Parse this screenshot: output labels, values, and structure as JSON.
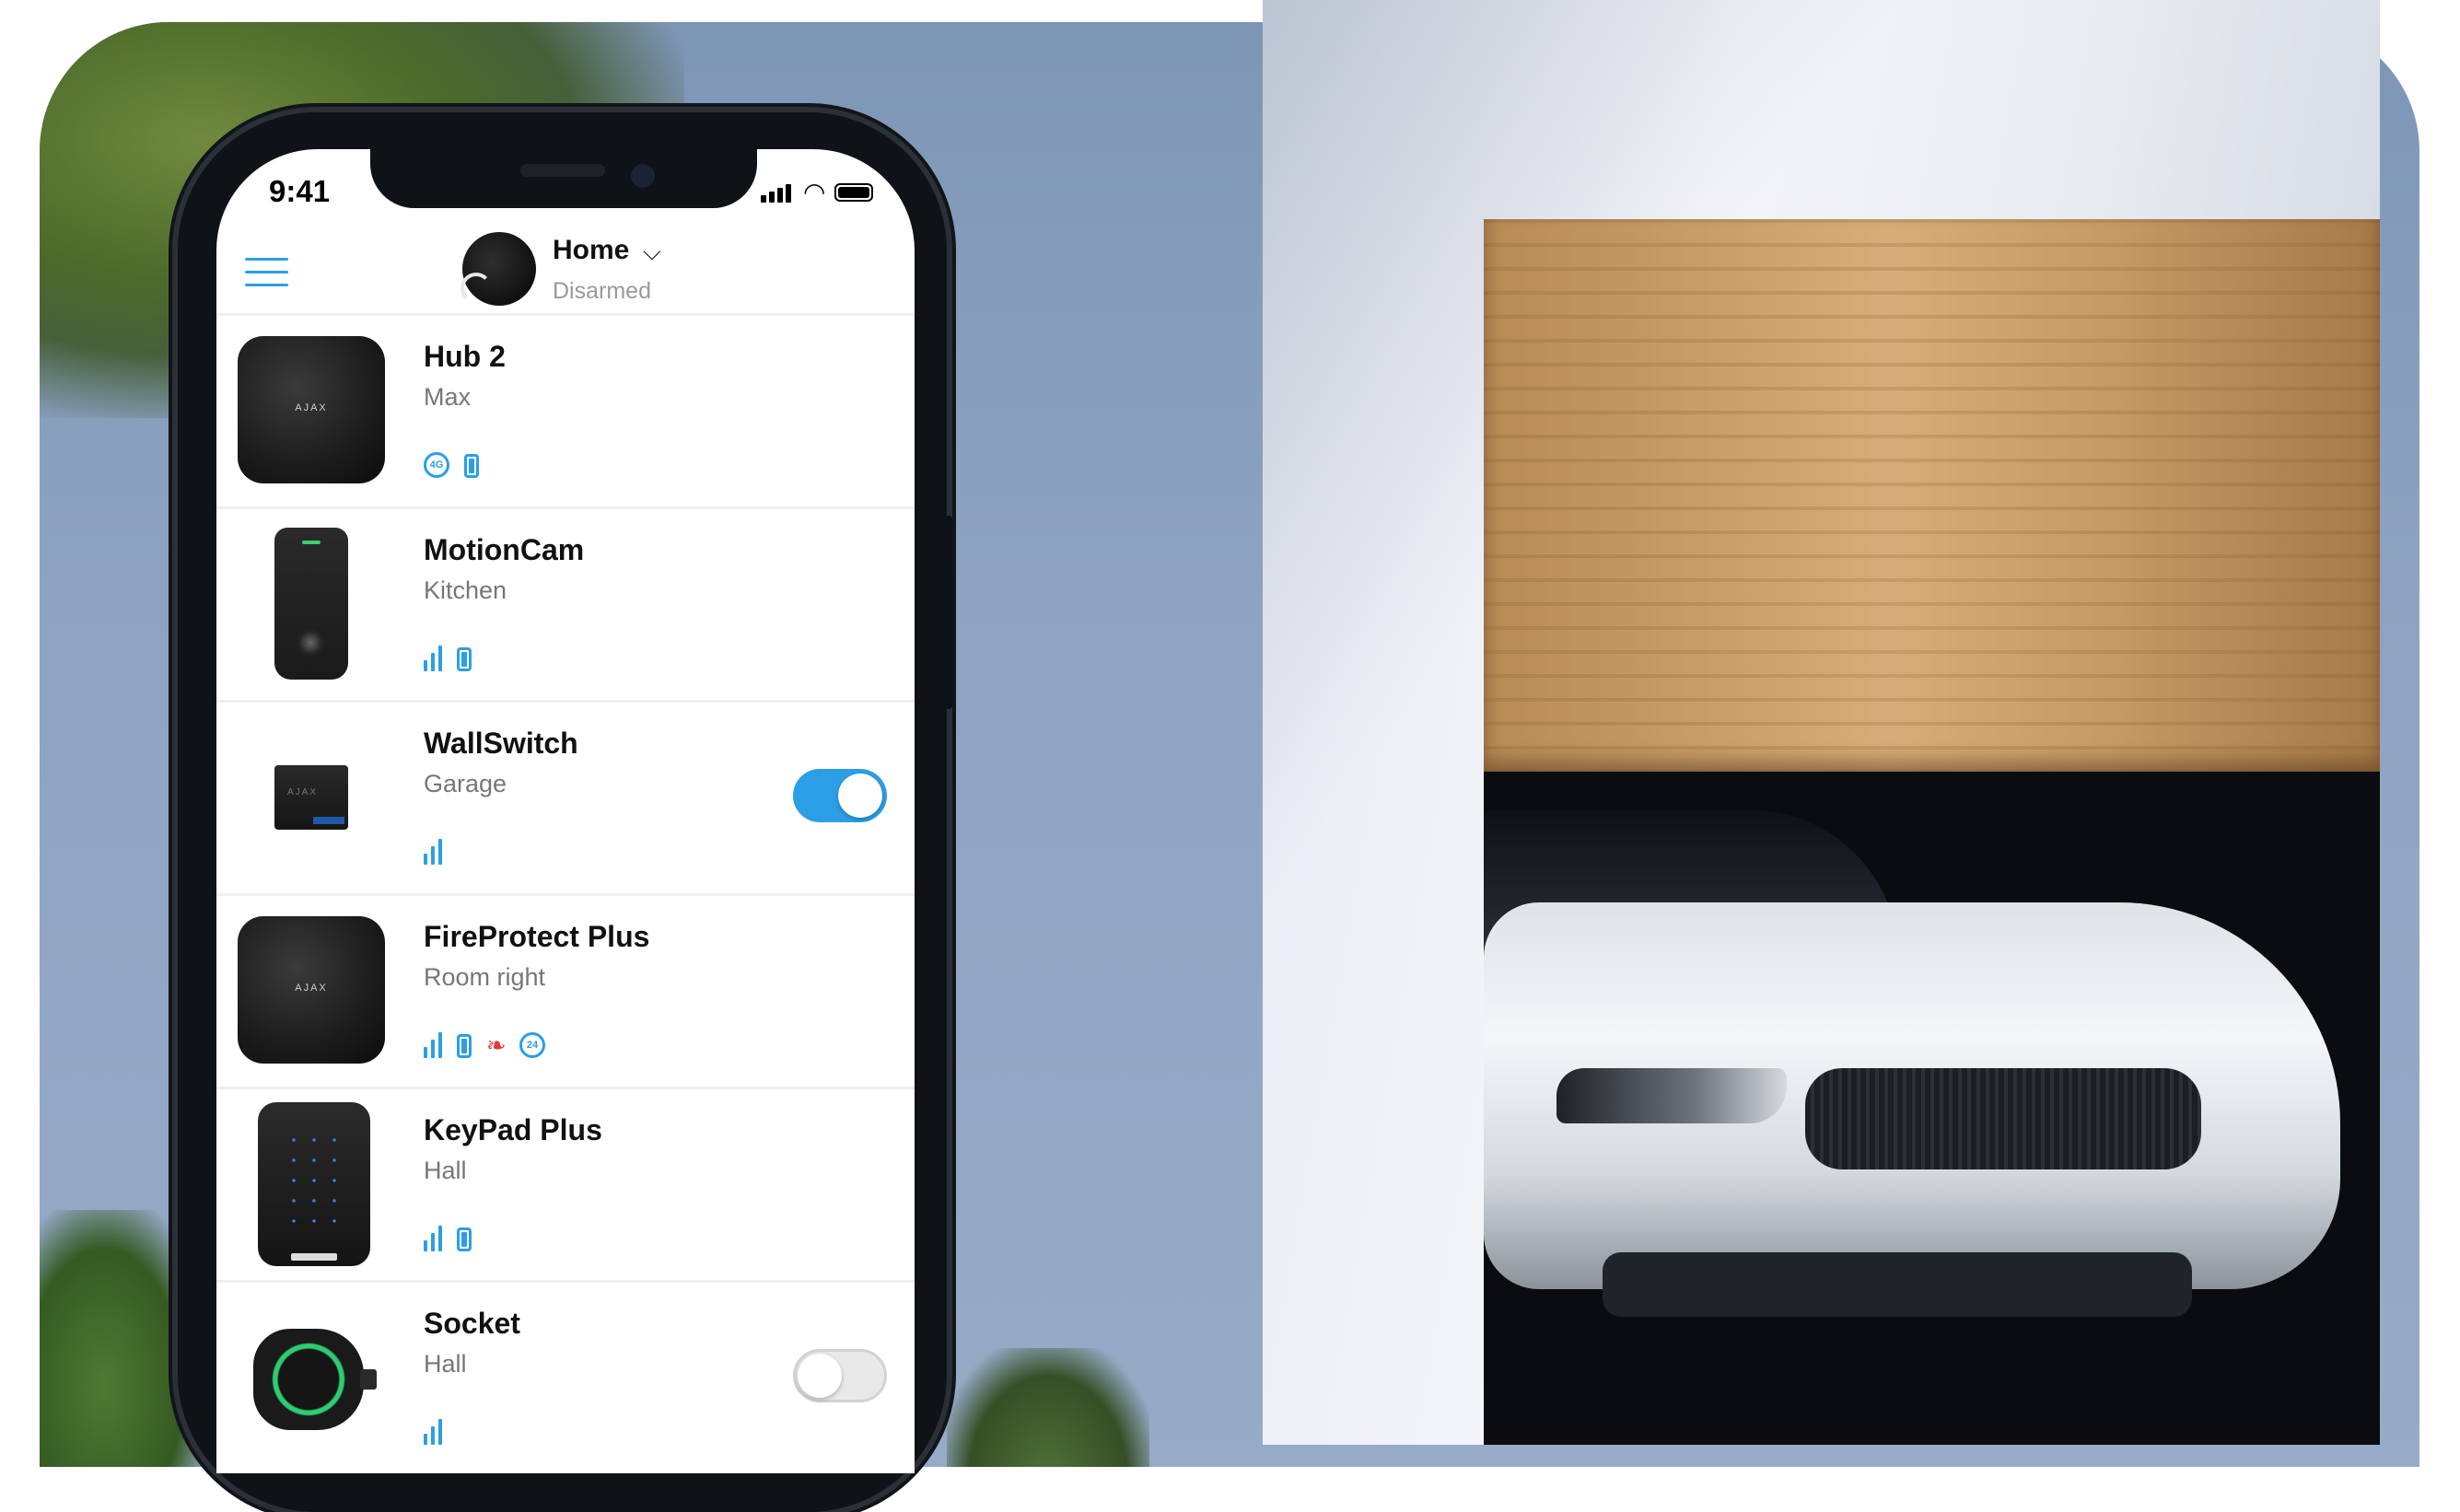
{
  "status_bar": {
    "time": "9:41"
  },
  "header": {
    "home_title": "Home",
    "home_status": "Disarmed"
  },
  "devices": [
    {
      "name": "Hub 2",
      "room": "Max",
      "image_logo": "AJAX",
      "icons": [
        "4g-icon",
        "battery-icon"
      ],
      "toggle": null
    },
    {
      "name": "MotionCam",
      "room": "Kitchen",
      "icons": [
        "signal-icon",
        "battery-icon"
      ],
      "toggle": null
    },
    {
      "name": "WallSwitch",
      "room": "Garage",
      "image_logo": "AJAX",
      "icons": [
        "signal-icon"
      ],
      "toggle": "on"
    },
    {
      "name": "FireProtect Plus",
      "room": "Room right",
      "image_logo": "AJAX",
      "icons": [
        "signal-icon",
        "battery-icon",
        "fire-sensor-icon",
        "24h-icon"
      ],
      "toggle": null
    },
    {
      "name": "KeyPad Plus",
      "room": "Hall",
      "icons": [
        "signal-icon",
        "battery-icon"
      ],
      "toggle": null
    },
    {
      "name": "Socket",
      "room": "Hall",
      "icons": [
        "signal-icon"
      ],
      "toggle": "off"
    }
  ],
  "icon_labels": {
    "badge_4g": "4G",
    "badge_24": "24"
  },
  "colors": {
    "accent": "#2b9fe6",
    "fire": "#e23a3a",
    "toggle_on": "#2b9fe6",
    "toggle_off": "#e9e9ea"
  }
}
